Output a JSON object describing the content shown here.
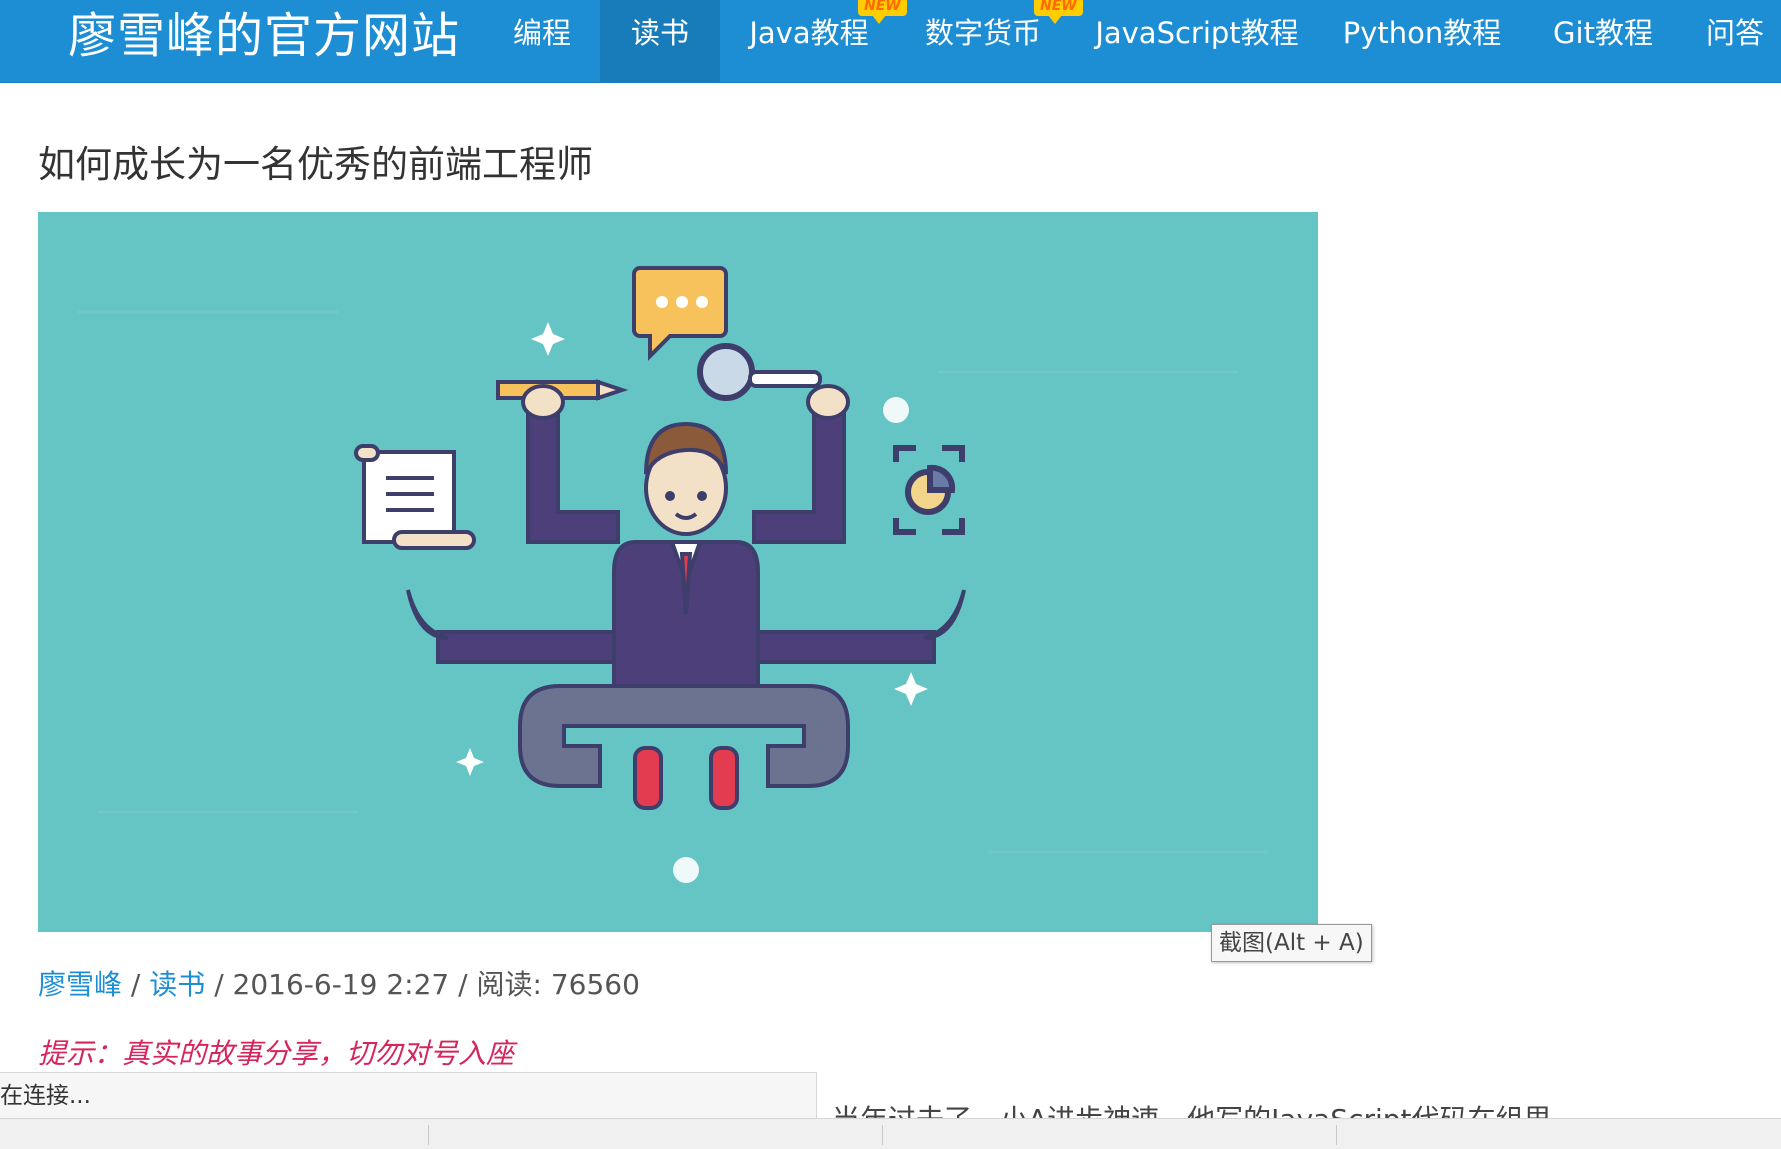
{
  "header": {
    "brand": "廖雪峰的官方网站",
    "nav": [
      {
        "label": "编程",
        "active": false,
        "badge": ""
      },
      {
        "label": "读书",
        "active": true,
        "badge": ""
      },
      {
        "label": "Java教程",
        "active": false,
        "badge": "NEW"
      },
      {
        "label": "数字货币",
        "active": false,
        "badge": "NEW"
      },
      {
        "label": "JavaScript教程",
        "active": false,
        "badge": ""
      },
      {
        "label": "Python教程",
        "active": false,
        "badge": ""
      },
      {
        "label": "Git教程",
        "active": false,
        "badge": ""
      },
      {
        "label": "问答",
        "active": false,
        "badge": ""
      }
    ]
  },
  "article": {
    "title": "如何成长为一名优秀的前端工程师",
    "author": "廖雪峰",
    "category": "读书",
    "date": "2016-6-19 2:27",
    "reads_label": "阅读:",
    "reads": "76560",
    "separator": "/",
    "tip": "提示：真实的故事分享，切勿对号入座",
    "partial_text": "当年过去了，小A进步神速，他写的JavaScript代码在组里..."
  },
  "tooltip": {
    "text": "截图(Alt + A)"
  },
  "status": {
    "text": "在连接..."
  },
  "colors": {
    "header_bg": "#1e8ed4",
    "active_nav": "#177cb9",
    "hero_bg": "#65c4c4",
    "link": "#1e8ed4",
    "tip": "#d6245c"
  }
}
